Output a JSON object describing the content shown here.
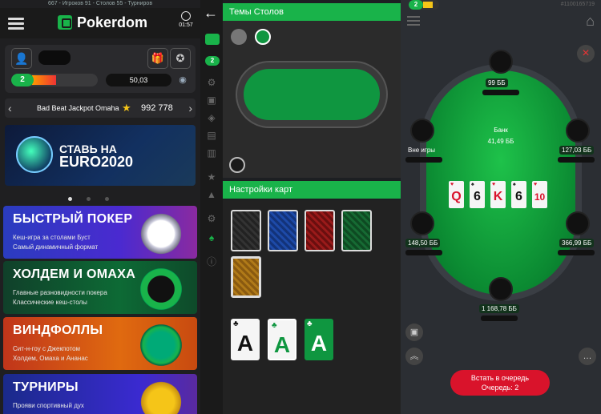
{
  "lobby": {
    "top_stats": "667 - Игроков  91 - Столов  55 - Турниров",
    "brand": "Pokerdom",
    "time": "01:57",
    "level": "2",
    "balance": "50,03",
    "jackpot_name": "Bad Beat Jackpot Omaha",
    "jackpot_value": "992 778",
    "banner_line1": "СТАВЬ НА",
    "banner_line2": "EURO2020",
    "games": [
      {
        "title": "БЫСТРЫЙ ПОКЕР",
        "line1": "Кеш-игра за столами Буст",
        "line2": "Самый динамичный формат"
      },
      {
        "title": "ХОЛДЕМ И ОМАХА",
        "line1": "Главные разновидности покера",
        "line2": "Классические кеш-столы"
      },
      {
        "title": "ВИНДФОЛЛЫ",
        "line1": "Сит-н-гоу с Джекпотом",
        "line2": "Холдем, Омаха и Ананас"
      },
      {
        "title": "ТУРНИРЫ",
        "line1": "Прояви спортивный дух",
        "line2": ""
      }
    ]
  },
  "settings": {
    "level": "2",
    "themes_header": "Темы Столов",
    "cards_header": "Настройки карт",
    "face_card_letter": "A",
    "face_card_suit": "♣"
  },
  "table": {
    "level": "2",
    "table_id": "#1100165719",
    "bank_label": "Банк",
    "bank_value": "41,49 ББ",
    "seats": [
      {
        "stack": "99 ББ"
      },
      {
        "stack": "Вне игры"
      },
      {
        "stack": "127,03 ББ"
      },
      {
        "stack": "148,50 ББ"
      },
      {
        "stack": "366,99 ББ"
      },
      {
        "stack": "1 168,78 ББ"
      }
    ],
    "board": [
      {
        "rank": "Q",
        "suit": "♥",
        "color": "#d9132b"
      },
      {
        "rank": "6",
        "suit": "♠",
        "color": "#111111"
      },
      {
        "rank": "K",
        "suit": "♥",
        "color": "#d9132b"
      },
      {
        "rank": "6",
        "suit": "♠",
        "color": "#111111"
      },
      {
        "rank": "10",
        "suit": "♥",
        "color": "#d9132b"
      }
    ],
    "queue_line1": "Встать в очередь",
    "queue_line2": "Очередь: 2"
  }
}
